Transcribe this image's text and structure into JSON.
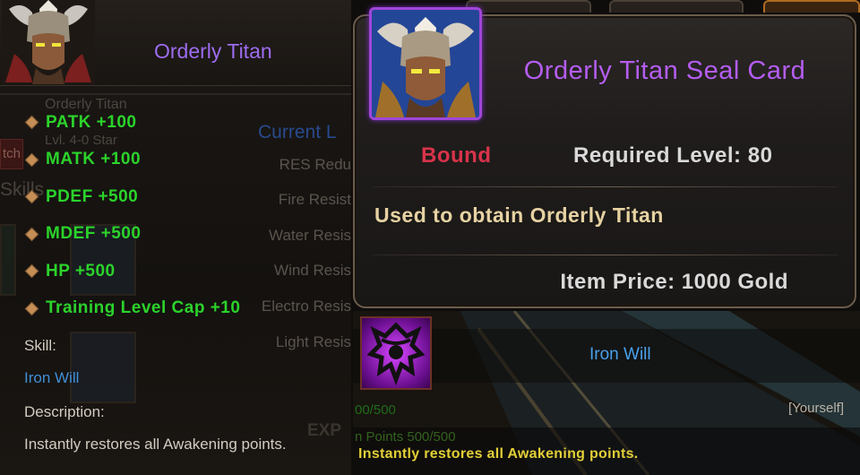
{
  "hero_panel": {
    "name": "Orderly Titan",
    "background_text": {
      "faded_name": "Orderly Titan",
      "faded_level": "Lvl. 4-0 Star",
      "tab_fragment": "tch",
      "skills_fragment": "Skills",
      "current_fragment": "Current L",
      "res_labels": [
        "RES Redu",
        "Fire Resist",
        "Water Resis",
        "Wind Resis",
        "Electro Resis",
        "Light Resis"
      ],
      "exp_fragment": "EXP"
    },
    "stats": [
      "PATK +100",
      "MATK +100",
      "PDEF +500",
      "MDEF +500",
      "HP +500",
      "Training Level Cap +10"
    ],
    "skill_label": "Skill:",
    "skill_name": "Iron Will",
    "description_label": "Description:",
    "description_text": "Instantly restores all Awakening points.",
    "colors": {
      "name": "#9d6cf0",
      "stats": "#2bd32b",
      "skill_name": "#3f8fd6"
    }
  },
  "seal_card_tooltip": {
    "title": "Orderly Titan Seal Card",
    "binding": "Bound",
    "required_level": "Required Level: 80",
    "usage": "Used to obtain Orderly Titan",
    "price": "Item Price: 1000 Gold",
    "icon": "titan-portrait-icon",
    "colors": {
      "title": "#b45df0",
      "bound": "#d8334a",
      "usage": "#e6d2a2",
      "icon_border": "#a046d8"
    }
  },
  "iron_will_tooltip": {
    "name": "Iron Will",
    "target": "[Yourself]",
    "faded_cost": "00/500",
    "faded_points": "n Points 500/500",
    "description": "Instantly restores all Awakening points.",
    "icon": "iron-will-skill-icon",
    "colors": {
      "name": "#48a0ec",
      "description": "#e2cf38"
    }
  }
}
